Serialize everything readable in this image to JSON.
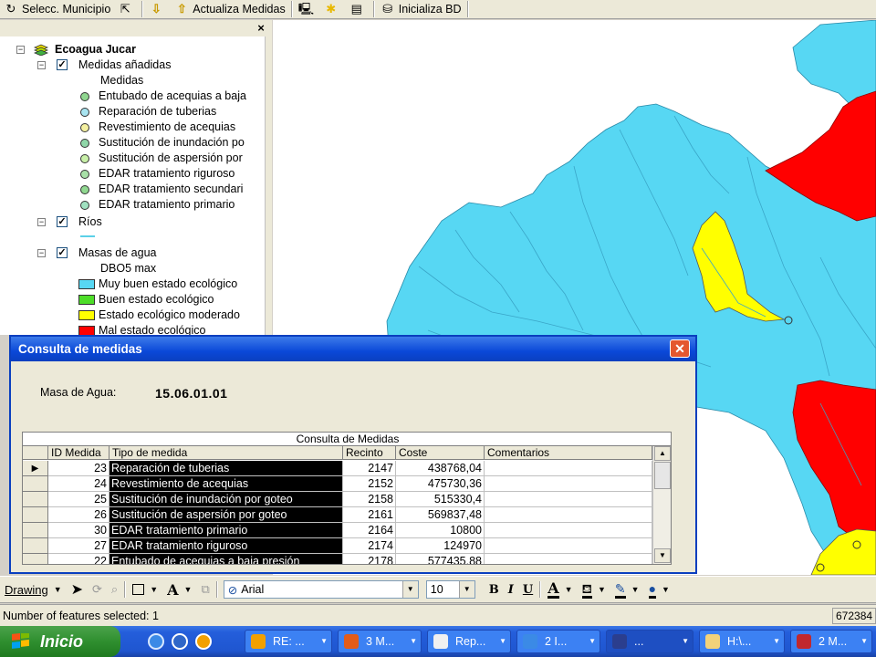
{
  "toolbar": {
    "selecc_municipio": "Selecc. Municipio",
    "actualiza_medidas": "Actualiza Medidas",
    "inicializa_bd": "Inicializa BD"
  },
  "toc": {
    "root": "Ecoagua Jucar",
    "group_medidas": "Medidas añadidas",
    "medidas_sub": "Medidas",
    "medidas": [
      {
        "label": "Entubado de acequias a baja",
        "color": "#8fd68f"
      },
      {
        "label": "Reparación de tuberias",
        "color": "#a8e4f0"
      },
      {
        "label": "Revestimiento de acequias",
        "color": "#f4f0a0"
      },
      {
        "label": "Sustitución de inundación po",
        "color": "#8fd6a8"
      },
      {
        "label": "Sustitución de aspersión por",
        "color": "#c8f0a8"
      },
      {
        "label": "EDAR tratamiento riguroso",
        "color": "#a8e0a8"
      },
      {
        "label": "EDAR tratamiento secundari",
        "color": "#90d890"
      },
      {
        "label": "EDAR tratamiento primario",
        "color": "#a0e0c0"
      }
    ],
    "group_rios": "Ríos",
    "rios_color": "#5bd0e8",
    "group_masas": "Masas de agua",
    "masas_sub": "DBO5 max",
    "masas": [
      {
        "label": "Muy buen estado ecológico",
        "color": "#57d7f3"
      },
      {
        "label": "Buen estado ecológico",
        "color": "#4ddd28"
      },
      {
        "label": "Estado ecológico moderado",
        "color": "#ffff00"
      },
      {
        "label": "Mal estado ecológico",
        "color": "#ff0000"
      }
    ]
  },
  "dialog": {
    "title": "Consulta de medidas",
    "masa_label": "Masa de Agua:",
    "masa_value": "15.06.01.01",
    "grid_caption": "Consulta de Medidas",
    "columns": [
      "ID Medida",
      "Tipo de medida",
      "Recinto",
      "Coste",
      "Comentarios"
    ],
    "rows": [
      {
        "id": "23",
        "tipo": "Reparación de tuberias",
        "recinto": "2147",
        "coste": "438768,04",
        "comentarios": ""
      },
      {
        "id": "24",
        "tipo": "Revestimiento de acequias",
        "recinto": "2152",
        "coste": "475730,36",
        "comentarios": ""
      },
      {
        "id": "25",
        "tipo": "Sustitución de inundación por goteo",
        "recinto": "2158",
        "coste": "515330,4",
        "comentarios": ""
      },
      {
        "id": "26",
        "tipo": "Sustitución de aspersión por goteo",
        "recinto": "2161",
        "coste": "569837,48",
        "comentarios": ""
      },
      {
        "id": "30",
        "tipo": "EDAR tratamiento primario",
        "recinto": "2164",
        "coste": "10800",
        "comentarios": ""
      },
      {
        "id": "27",
        "tipo": "EDAR tratamiento riguroso",
        "recinto": "2174",
        "coste": "124970",
        "comentarios": ""
      },
      {
        "id": "22",
        "tipo": "Entubado de acequias a baja presión",
        "recinto": "2178",
        "coste": "577435,88",
        "comentarios": ""
      }
    ]
  },
  "drawbar": {
    "drawing": "Drawing",
    "text_tool": "A",
    "font": "Arial",
    "size": "10",
    "bold": "B",
    "italic": "I",
    "underline": "U",
    "font_color": "A"
  },
  "status": {
    "text": "Number of features selected: 1",
    "coord": "672384"
  },
  "taskbar": {
    "start": "Inicio",
    "tasks": [
      "RE: ...",
      "3 M...",
      "Rep...",
      "2 I...",
      "...",
      "H:\\...",
      "2 M..."
    ]
  },
  "map_colors": {
    "good": "#57d7f3",
    "moderate": "#ffff00",
    "bad": "#ff0000",
    "river": "#3aa6c8"
  }
}
